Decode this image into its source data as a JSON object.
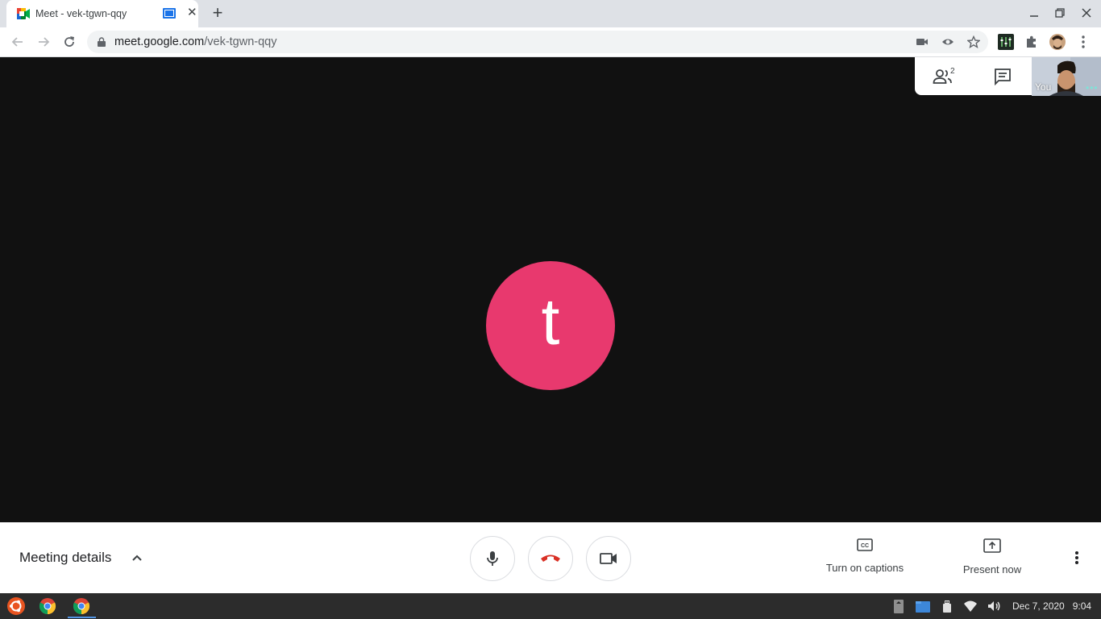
{
  "browser": {
    "tab_title": "Meet - vek-tgwn-qqy",
    "tab_close": "✕",
    "new_tab": "+",
    "url_host": "meet.google.com",
    "url_path": "/vek-tgwn-qqy"
  },
  "stage": {
    "participant_initial": "t",
    "participant_color": "#e8396e",
    "participants_count": "2",
    "self_view_label": "You",
    "self_view_dots": "•••"
  },
  "bottom_bar": {
    "meeting_details": "Meeting details",
    "captions_label": "Turn on captions",
    "present_label": "Present now"
  },
  "taskbar": {
    "date": "Dec 7, 2020",
    "time": "9:04"
  },
  "colors": {
    "accent": "#1a73e8",
    "hangup": "#d93025",
    "stage_bg": "#111111"
  }
}
